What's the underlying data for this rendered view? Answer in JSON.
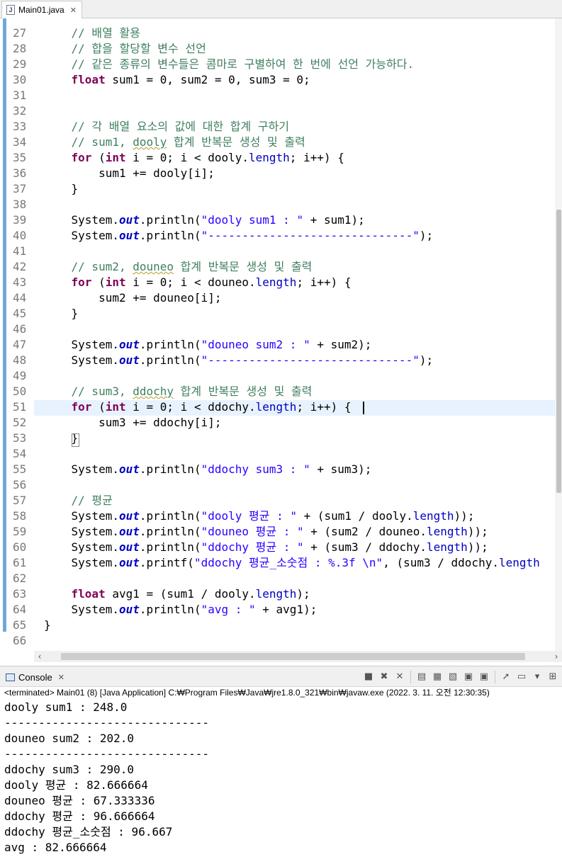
{
  "editor": {
    "tab_label": "Main01.java",
    "file_icon": "J",
    "lines": [
      {
        "n": "27",
        "html": "    <span class=\"cm\">// 배열 활용</span>"
      },
      {
        "n": "28",
        "html": "    <span class=\"cm\">// 합을 할당할 변수 선언</span>"
      },
      {
        "n": "29",
        "html": "    <span class=\"cm\">// 같은 종류의 변수들은 콤마로 구별하여 한 번에 선언 가능하다.</span>"
      },
      {
        "n": "30",
        "html": "    <span class=\"kw\">float</span> sum1 = 0, sum2 = 0, sum3 = 0;"
      },
      {
        "n": "31",
        "html": ""
      },
      {
        "n": "32",
        "html": ""
      },
      {
        "n": "33",
        "html": "    <span class=\"cm\">// 각 배열 요소의 값에 대한 합계 구하기</span>"
      },
      {
        "n": "34",
        "html": "    <span class=\"cm\">// sum1, <span class=\"squig\">dooly</span> 합계 반복문 생성 및 출력</span>"
      },
      {
        "n": "35",
        "html": "    <span class=\"kw\">for</span> (<span class=\"kw\">int</span> i = 0; i &lt; dooly.<span class=\"fl\">length</span>; i++) {"
      },
      {
        "n": "36",
        "html": "        sum1 += dooly[i];"
      },
      {
        "n": "37",
        "html": "    }"
      },
      {
        "n": "38",
        "html": ""
      },
      {
        "n": "39",
        "html": "    System.<span class=\"fd\">out</span>.println(<span class=\"st\">\"dooly sum1 : \"</span> + sum1);"
      },
      {
        "n": "40",
        "html": "    System.<span class=\"fd\">out</span>.println(<span class=\"st\">\"------------------------------\"</span>);"
      },
      {
        "n": "41",
        "html": ""
      },
      {
        "n": "42",
        "html": "    <span class=\"cm\">// sum2, <span class=\"squig\">douneo</span> 합계 반복문 생성 및 출력</span>"
      },
      {
        "n": "43",
        "html": "    <span class=\"kw\">for</span> (<span class=\"kw\">int</span> i = 0; i &lt; douneo.<span class=\"fl\">length</span>; i++) {"
      },
      {
        "n": "44",
        "html": "        sum2 += douneo[i];"
      },
      {
        "n": "45",
        "html": "    }"
      },
      {
        "n": "46",
        "html": ""
      },
      {
        "n": "47",
        "html": "    System.<span class=\"fd\">out</span>.println(<span class=\"st\">\"douneo sum2 : \"</span> + sum2);"
      },
      {
        "n": "48",
        "html": "    System.<span class=\"fd\">out</span>.println(<span class=\"st\">\"------------------------------\"</span>);"
      },
      {
        "n": "49",
        "html": ""
      },
      {
        "n": "50",
        "html": "    <span class=\"cm\">// sum3, <span class=\"squig\">ddochy</span> 합계 반복문 생성 및 출력</span>"
      },
      {
        "n": "51",
        "html": "    <span class=\"kw\">for</span> (<span class=\"kw\">int</span> i = 0; i &lt; ddochy.<span class=\"fl\">length</span>; i++) {"
      },
      {
        "n": "52",
        "html": "        sum3 += ddochy[i];"
      },
      {
        "n": "53",
        "html": "    }"
      },
      {
        "n": "54",
        "html": ""
      },
      {
        "n": "55",
        "html": "    System.<span class=\"fd\">out</span>.println(<span class=\"st\">\"ddochy sum3 : \"</span> + sum3);"
      },
      {
        "n": "56",
        "html": ""
      },
      {
        "n": "57",
        "html": "    <span class=\"cm\">// 평균</span>"
      },
      {
        "n": "58",
        "html": "    System.<span class=\"fd\">out</span>.println(<span class=\"st\">\"dooly 평균 : \"</span> + (sum1 / dooly.<span class=\"fl\">length</span>));"
      },
      {
        "n": "59",
        "html": "    System.<span class=\"fd\">out</span>.println(<span class=\"st\">\"douneo 평균 : \"</span> + (sum2 / douneo.<span class=\"fl\">length</span>));"
      },
      {
        "n": "60",
        "html": "    System.<span class=\"fd\">out</span>.println(<span class=\"st\">\"ddochy 평균 : \"</span> + (sum3 / ddochy.<span class=\"fl\">length</span>));"
      },
      {
        "n": "61",
        "html": "    System.<span class=\"fd\">out</span>.printf(<span class=\"st\">\"ddochy 평균_소숫점 : %.3f \\n\"</span>, (sum3 / ddochy.<span class=\"fl\">length</span>"
      },
      {
        "n": "62",
        "html": ""
      },
      {
        "n": "63",
        "html": "    <span class=\"kw\">float</span> avg1 = (sum1 / dooly.<span class=\"fl\">length</span>);"
      },
      {
        "n": "64",
        "html": "    System.<span class=\"fd\">out</span>.println(<span class=\"st\">\"avg : \"</span> + avg1);"
      },
      {
        "n": "65",
        "html": "}"
      },
      {
        "n": "66",
        "html": ""
      }
    ]
  },
  "console": {
    "tab_label": "Console",
    "status": "<terminated> Main01 (8) [Java Application] C:₩Program Files₩Java₩jre1.8.0_321₩bin₩javaw.exe (2022. 3. 11. 오전 12:30:35)",
    "output": [
      "dooly sum1 : 248.0",
      "------------------------------",
      "douneo sum2 : 202.0",
      "------------------------------",
      "ddochy sum3 : 290.0",
      "dooly 평균 : 82.666664",
      "douneo 평균 : 67.333336",
      "ddochy 평균 : 96.666664",
      "ddochy 평균_소숫점 : 96.667",
      "avg : 82.666664"
    ],
    "toolbar_icons": [
      "terminate-icon",
      "remove-launch-icon",
      "remove-all-terminated-icon",
      "clear-console-icon",
      "scroll-lock-icon",
      "word-wrap-icon",
      "show-on-stdout-icon",
      "show-on-stderr-icon",
      "pin-console-icon",
      "display-selected-console-icon",
      "open-console-icon",
      "new-console-view-icon"
    ]
  }
}
